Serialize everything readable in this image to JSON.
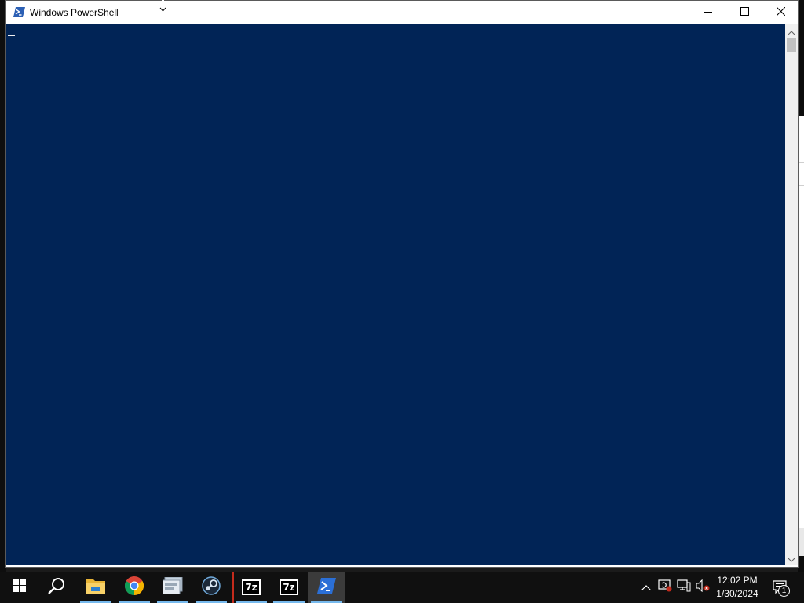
{
  "window": {
    "title": "Windows PowerShell",
    "icon": "powershell-icon",
    "controls": [
      "minimize-icon",
      "maximize-icon",
      "close-icon"
    ]
  },
  "console": {
    "background": "#012456",
    "text": ""
  },
  "taskbar": {
    "items": [
      {
        "name": "start",
        "icon": "windows-logo-icon"
      },
      {
        "name": "search",
        "icon": "search-icon"
      },
      {
        "name": "file-explorer",
        "icon": "folder-icon"
      },
      {
        "name": "chrome",
        "icon": "chrome-icon"
      },
      {
        "name": "app-window",
        "icon": "app-window-icon"
      },
      {
        "name": "steam",
        "icon": "steam-icon"
      },
      {
        "name": "7zip-1",
        "icon": "7zip-icon",
        "label": "7z"
      },
      {
        "name": "7zip-2",
        "icon": "7zip-icon",
        "label": "7z"
      },
      {
        "name": "powershell",
        "icon": "powershell-icon",
        "active": true
      }
    ],
    "tray": {
      "icons": [
        "chevron-up-icon",
        "security-icon",
        "network-icon",
        "volume-muted-icon"
      ],
      "time": "12:02 PM",
      "date": "1/30/2024",
      "notification_count": "1"
    },
    "accent": "#76b9ed"
  }
}
